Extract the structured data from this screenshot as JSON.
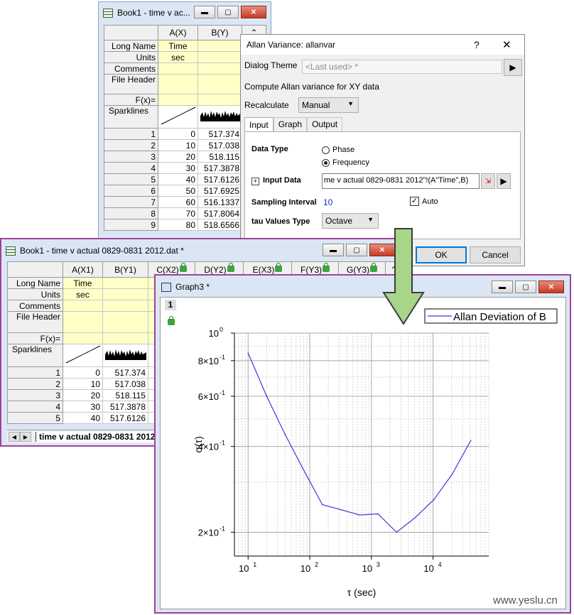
{
  "book_back": {
    "title": "Book1 - time v ac...",
    "col_headers": [
      "A(X)",
      "B(Y)"
    ],
    "row_labels": [
      "Long Name",
      "Units",
      "Comments",
      "File Header",
      "F(x)=",
      "Sparklines"
    ],
    "long_name": [
      "Time",
      ""
    ],
    "units": [
      "sec",
      ""
    ],
    "rows": [
      {
        "n": "1",
        "a": "0",
        "b": "517.374"
      },
      {
        "n": "2",
        "a": "10",
        "b": "517.038"
      },
      {
        "n": "3",
        "a": "20",
        "b": "518.115"
      },
      {
        "n": "4",
        "a": "30",
        "b": "517.3878"
      },
      {
        "n": "5",
        "a": "40",
        "b": "517.6126"
      },
      {
        "n": "6",
        "a": "50",
        "b": "517.6925"
      },
      {
        "n": "7",
        "a": "60",
        "b": "516.1337"
      },
      {
        "n": "8",
        "a": "70",
        "b": "517.8064"
      },
      {
        "n": "9",
        "a": "80",
        "b": "518.6566"
      }
    ]
  },
  "dialog": {
    "title": "Allan Variance: allanvar",
    "help": "?",
    "close": "✕",
    "theme_label": "Dialog Theme",
    "theme_value": "<Last used> *",
    "description": "Compute Allan variance for XY data",
    "recalc_label": "Recalculate",
    "recalc_value": "Manual",
    "tabs": [
      "Input",
      "Graph",
      "Output"
    ],
    "data_type_label": "Data Type",
    "radio_phase": "Phase",
    "radio_frequency": "Frequency",
    "input_data_label": "Input Data",
    "input_data_value": "me v actual 0829-0831 2012\"!(A\"Time\",B)",
    "sampling_label": "Sampling Interval",
    "sampling_value": "10",
    "auto_label": "Auto",
    "tau_label": "tau Values Type",
    "tau_value": "Octave",
    "ok": "OK",
    "cancel": "Cancel"
  },
  "book_front": {
    "title": "Book1 - time v actual 0829-0831 2012.dat *",
    "col_headers": [
      "A(X1)",
      "B(Y1)",
      "C(X2)",
      "D(Y2)",
      "E(X3)",
      "F(Y3)",
      "G(Y3)"
    ],
    "row_labels": [
      "Long Name",
      "Units",
      "Comments",
      "File Header",
      "F(x)=",
      "Sparklines"
    ],
    "long_name": "Time",
    "units": "sec",
    "rows": [
      {
        "n": "1",
        "a": "0",
        "b": "517.374"
      },
      {
        "n": "2",
        "a": "10",
        "b": "517.038"
      },
      {
        "n": "3",
        "a": "20",
        "b": "518.115"
      },
      {
        "n": "4",
        "a": "30",
        "b": "517.3878"
      },
      {
        "n": "5",
        "a": "40",
        "b": "517.6126"
      }
    ],
    "sheet_tab": "time v actual 0829-0831 2012"
  },
  "graph": {
    "title": "Graph3 *",
    "layer": "1"
  },
  "chart_data": {
    "type": "line",
    "series": [
      {
        "name": "Allan Deviation of B",
        "x": [
          10,
          20,
          40,
          80,
          160,
          320,
          640,
          1280,
          2560,
          5120,
          10240,
          20480,
          40960
        ],
        "y": [
          0.85,
          0.6,
          0.44,
          0.33,
          0.25,
          0.24,
          0.23,
          0.232,
          0.2,
          0.225,
          0.26,
          0.32,
          0.42
        ],
        "color": "#3a3adf"
      }
    ],
    "xlabel": "τ (sec)",
    "ylabel": "σ(τ)",
    "x_scale": "log",
    "y_scale": "log",
    "xlim": [
      6,
      80000
    ],
    "ylim": [
      0.165,
      1.0
    ],
    "x_ticks": [
      {
        "v": 10,
        "b": "10",
        "e": "1"
      },
      {
        "v": 100,
        "b": "10",
        "e": "2"
      },
      {
        "v": 1000,
        "b": "10",
        "e": "3"
      },
      {
        "v": 10000,
        "b": "10",
        "e": "4"
      }
    ],
    "y_ticks": [
      {
        "v": 1,
        "b": "10",
        "e": "0"
      },
      {
        "v": 0.8,
        "b": "8×10",
        "e": "-1"
      },
      {
        "v": 0.6,
        "b": "6×10",
        "e": "-1"
      },
      {
        "v": 0.4,
        "b": "4×10",
        "e": "-1"
      },
      {
        "v": 0.2,
        "b": "2×10",
        "e": "-1"
      }
    ],
    "grid": true,
    "legend": "top-right"
  },
  "watermark": "www.yeslu.cn"
}
